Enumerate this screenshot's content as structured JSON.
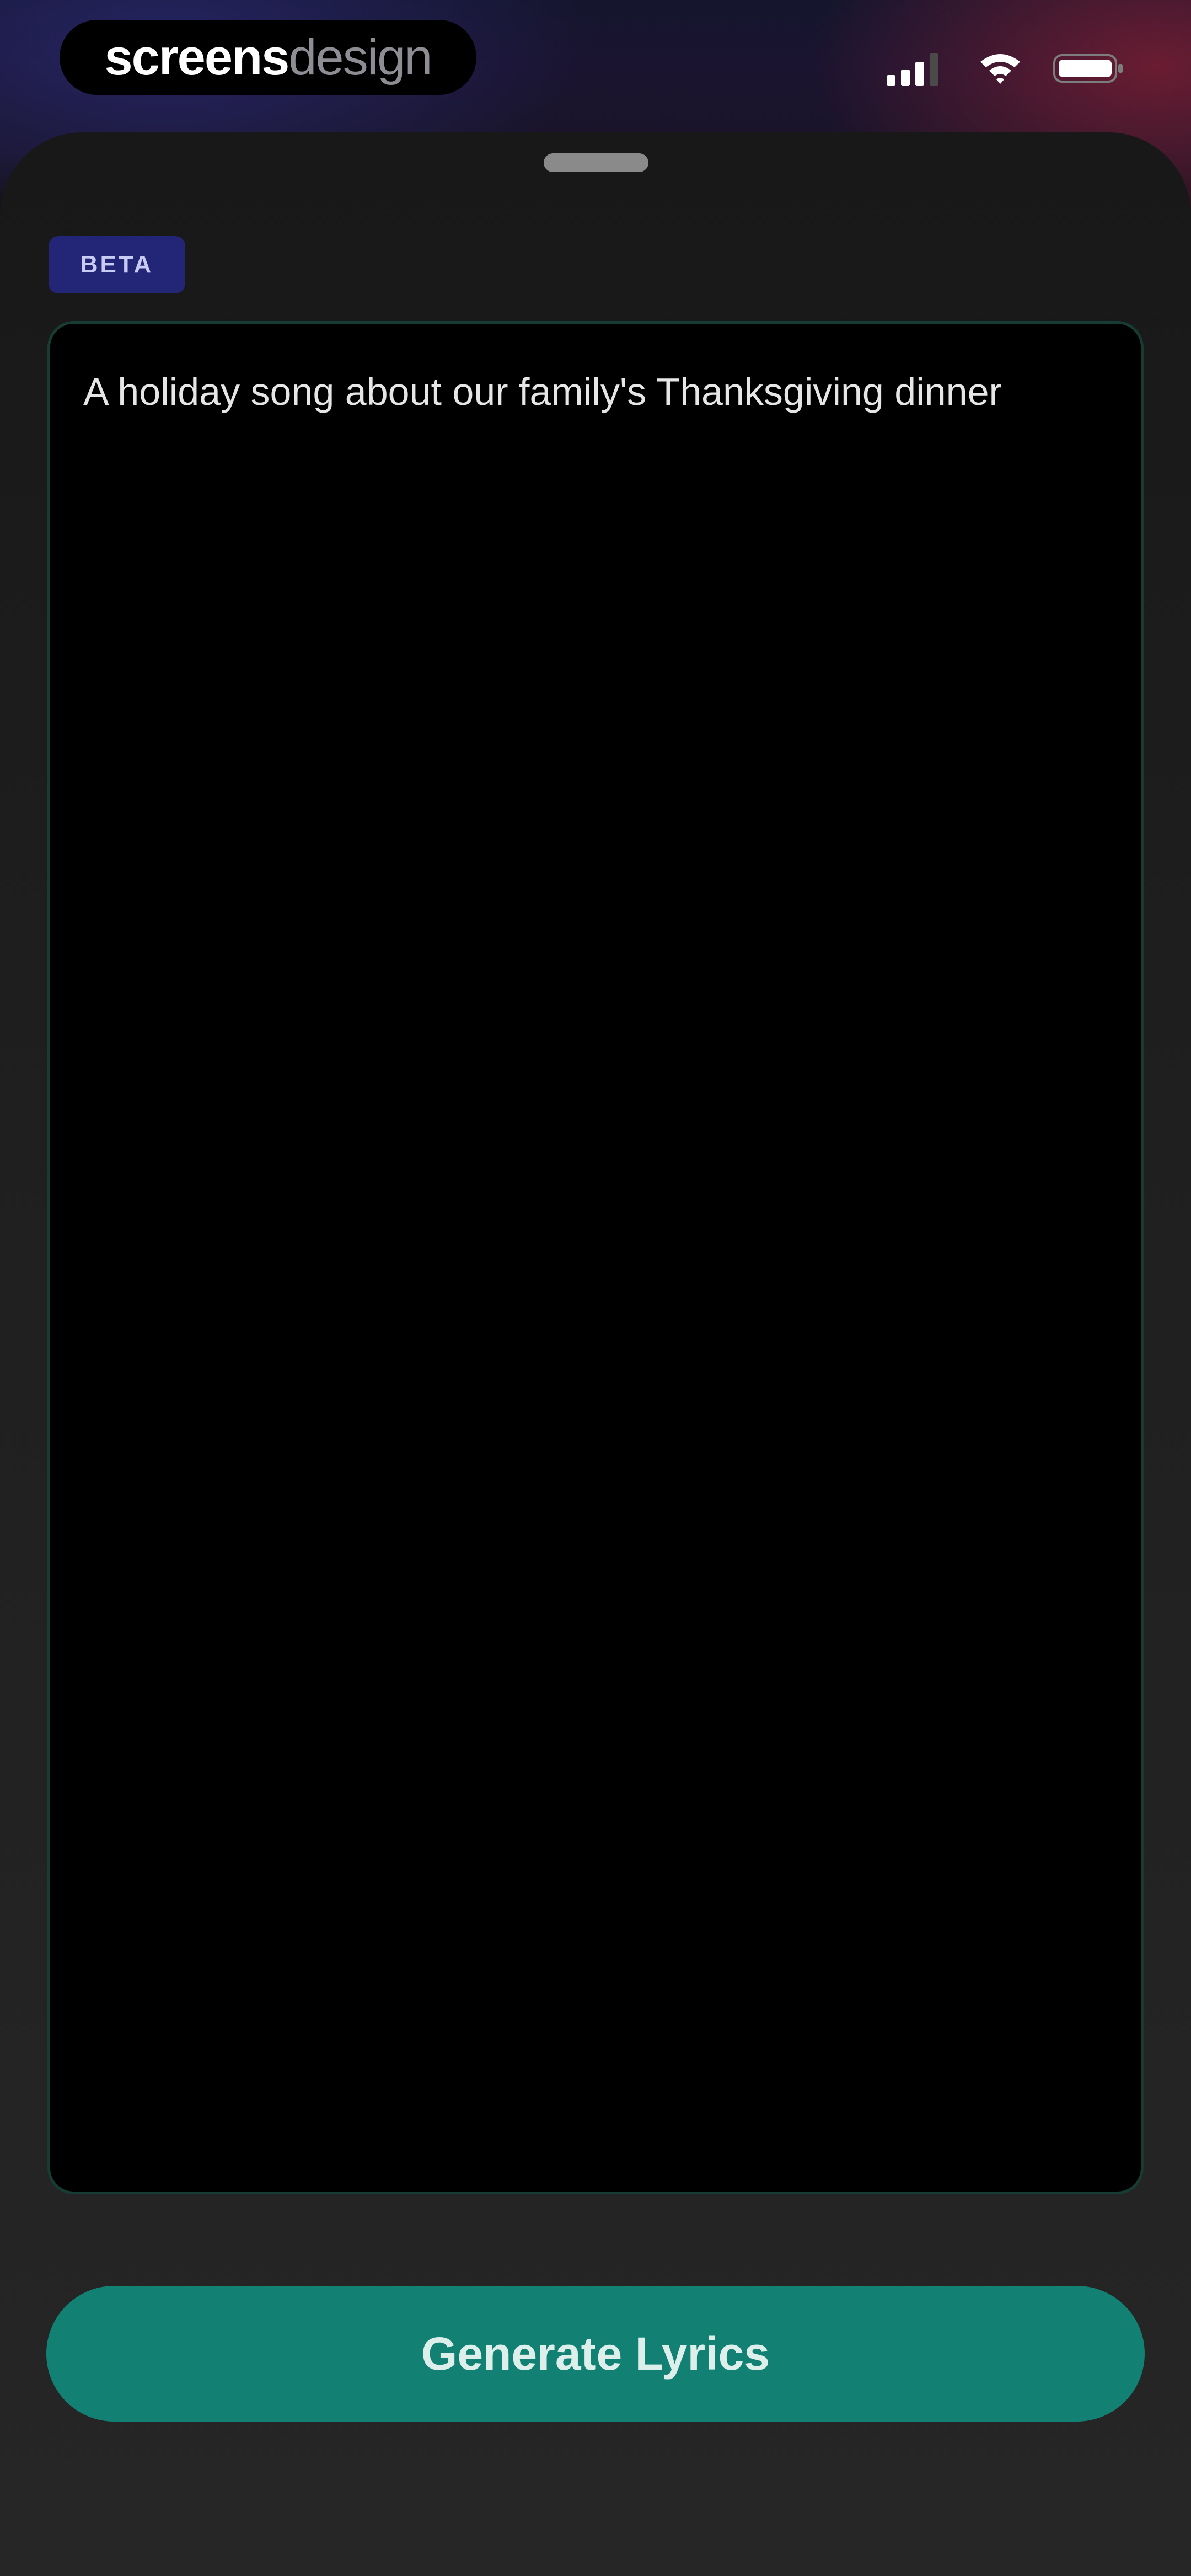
{
  "watermark": {
    "bold_part": "screens",
    "light_part": "design"
  },
  "status_bar": {
    "icons": [
      "cellular-signal-icon",
      "wifi-icon",
      "battery-icon"
    ]
  },
  "sheet": {
    "badge": "BETA",
    "prompt": {
      "value": "A holiday song about our family's Thanksgiving dinner"
    },
    "generate_button": "Generate Lyrics"
  },
  "colors": {
    "accent": "#128174",
    "badge_bg": "#232577",
    "input_border": "#173c33",
    "sheet_bg": "#1f1f1f"
  }
}
